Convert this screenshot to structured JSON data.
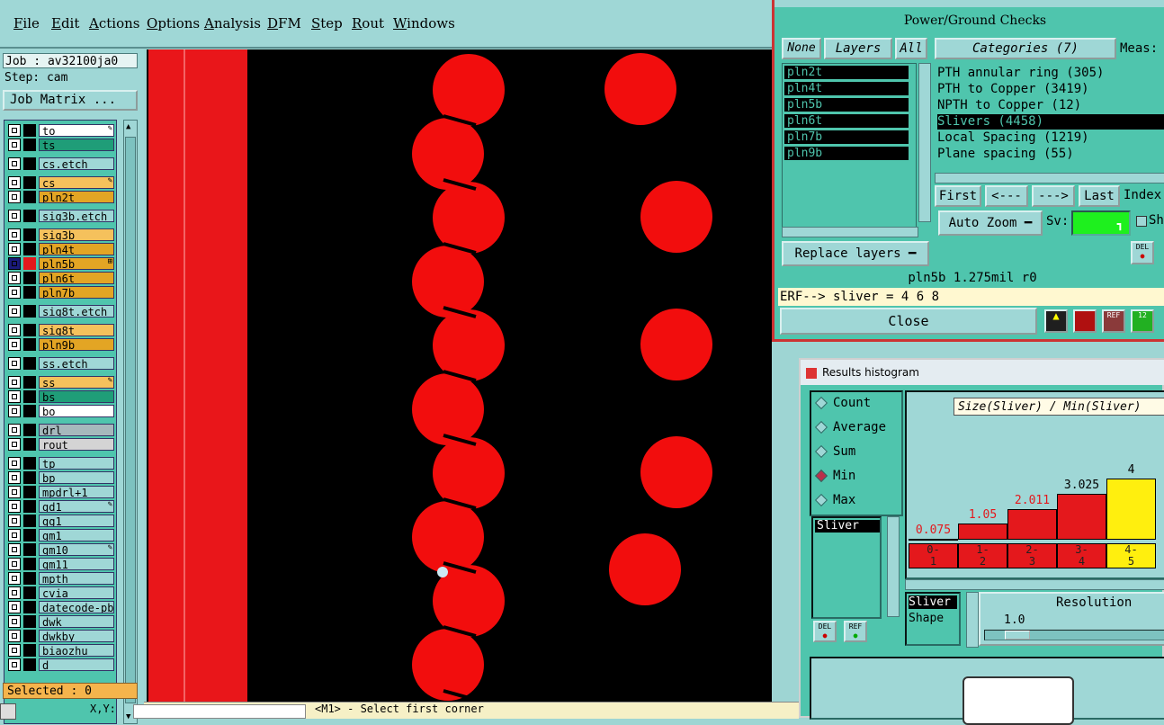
{
  "menubar": {
    "items": [
      "File",
      "Edit",
      "Actions",
      "Options",
      "Analysis",
      "DFM",
      "Step",
      "Rout",
      "Windows"
    ]
  },
  "job": {
    "job_line": "Job : av32100ja0",
    "step_line": "Step: cam",
    "matrix_button": "Job Matrix ..."
  },
  "layers": [
    {
      "name": "to",
      "color": "#ffffff",
      "mark": "✎"
    },
    {
      "name": "ts",
      "color": "#1f9d78",
      "mark": ""
    },
    {
      "name": "cs.etch",
      "color": "#9fd7d6",
      "mark": ""
    },
    {
      "name": "cs",
      "color": "#f5c15c",
      "mark": "✎"
    },
    {
      "name": "pln2t",
      "color": "#e3a524",
      "mark": ""
    },
    {
      "name": "sig3b.etch",
      "color": "#9fd7d6",
      "mark": ""
    },
    {
      "name": "sig3b",
      "color": "#f5c15c",
      "mark": ""
    },
    {
      "name": "pln4t",
      "color": "#e3a524",
      "mark": ""
    },
    {
      "name": "pln5b",
      "color": "#e3a524",
      "mark": "⊞"
    },
    {
      "name": "pln6t",
      "color": "#e3a524",
      "mark": ""
    },
    {
      "name": "pln7b",
      "color": "#e3a524",
      "mark": ""
    },
    {
      "name": "sig8t.etch",
      "color": "#9fd7d6",
      "mark": ""
    },
    {
      "name": "sig8t",
      "color": "#f5c15c",
      "mark": ""
    },
    {
      "name": "pln9b",
      "color": "#e3a524",
      "mark": ""
    },
    {
      "name": "ss.etch",
      "color": "#9fd7d6",
      "mark": ""
    },
    {
      "name": "ss",
      "color": "#f5c15c",
      "mark": "✎"
    },
    {
      "name": "bs",
      "color": "#1f9d78",
      "mark": ""
    },
    {
      "name": "bo",
      "color": "#ffffff",
      "mark": ""
    },
    {
      "name": "drl",
      "color": "#a6b8bc",
      "mark": ""
    },
    {
      "name": "rout",
      "color": "#d4d4d4",
      "mark": ""
    },
    {
      "name": "tp",
      "color": "#9fd7d6",
      "mark": ""
    },
    {
      "name": "bp",
      "color": "#9fd7d6",
      "mark": ""
    },
    {
      "name": "mpdrl+1",
      "color": "#9fd7d6",
      "mark": ""
    },
    {
      "name": "gd1",
      "color": "#9fd7d6",
      "mark": "✎"
    },
    {
      "name": "gg1",
      "color": "#9fd7d6",
      "mark": ""
    },
    {
      "name": "gm1",
      "color": "#9fd7d6",
      "mark": ""
    },
    {
      "name": "gm10",
      "color": "#9fd7d6",
      "mark": "✎"
    },
    {
      "name": "gm11",
      "color": "#9fd7d6",
      "mark": ""
    },
    {
      "name": "mpth",
      "color": "#9fd7d6",
      "mark": ""
    },
    {
      "name": "cvia",
      "color": "#9fd7d6",
      "mark": ""
    },
    {
      "name": "datecode-pbe",
      "color": "#9fd7d6",
      "mark": ""
    },
    {
      "name": "dwk",
      "color": "#9fd7d6",
      "mark": ""
    },
    {
      "name": "dwkby",
      "color": "#9fd7d6",
      "mark": ""
    },
    {
      "name": "biaozhu",
      "color": "#9fd7d6",
      "mark": ""
    },
    {
      "name": "d",
      "color": "#9fd7d6",
      "mark": ""
    }
  ],
  "selected_text": "Selected : 0",
  "status": {
    "xy_label": "X,Y:",
    "prompt": "<M1> - Select first corner"
  },
  "power_ground": {
    "title": "Power/Ground Checks",
    "none_button": "None",
    "layers_button": "Layers",
    "all_button": "All",
    "categories_button": "Categories (7)",
    "meas_label": "Meas:",
    "layer_items": [
      "pln2t",
      "pln4t",
      "pln5b",
      "pln6t",
      "pln7b",
      "pln9b"
    ],
    "categories": [
      {
        "label": "PTH annular ring (305)",
        "selected": false
      },
      {
        "label": "PTH to Copper (3419)",
        "selected": false
      },
      {
        "label": "NPTH to Copper (12)",
        "selected": false
      },
      {
        "label": "Slivers (4458)",
        "selected": true
      },
      {
        "label": "Local Spacing (1219)",
        "selected": false
      },
      {
        "label": "Plane spacing (55)",
        "selected": false
      }
    ],
    "nav": {
      "first": "First",
      "prev": "<---",
      "next": "--->",
      "last": "Last",
      "index": "Index:"
    },
    "auto_zoom": "Auto Zoom",
    "sv_label": "Sv:",
    "sh_label": "Sh",
    "replace_layers": "Replace layers",
    "info_line": "pln5b 1.275mil  r0",
    "erf_line": "ERF--> sliver = 4 6 8",
    "close_button": "Close",
    "del_label": "DEL"
  },
  "histogram": {
    "title": "Results histogram",
    "modes": [
      {
        "label": "Count",
        "on": false
      },
      {
        "label": "Average",
        "on": false
      },
      {
        "label": "Sum",
        "on": false
      },
      {
        "label": "Min",
        "on": true
      },
      {
        "label": "Max",
        "on": false
      }
    ],
    "list_items": [
      "Sliver"
    ],
    "heading": "Size(Sliver) / Min(Sliver)",
    "buckets": [
      {
        "label": "0-\n1",
        "value": 0.075,
        "value_text": "0.075",
        "color": "#e4181c",
        "label_color": "#e4181c"
      },
      {
        "label": "1-\n2",
        "value": 1.05,
        "value_text": "1.05",
        "color": "#e4181c",
        "label_color": "#e4181c"
      },
      {
        "label": "2-\n3",
        "value": 2.011,
        "value_text": "2.011",
        "color": "#e4181c",
        "label_color": "#e4181c"
      },
      {
        "label": "3-\n4",
        "value": 3.025,
        "value_text": "3.025",
        "color": "#e4181c",
        "label_color": "#000000"
      },
      {
        "label": "4-\n5",
        "value": 4,
        "value_text": "4",
        "color": "#ffef0e",
        "label_color": "#000000"
      }
    ],
    "attr_items": [
      "Sliver",
      "Shape"
    ],
    "resolution_label": "Resolution",
    "resolution_value": "1.0",
    "del_label": "DEL",
    "ref_label": "REF"
  }
}
